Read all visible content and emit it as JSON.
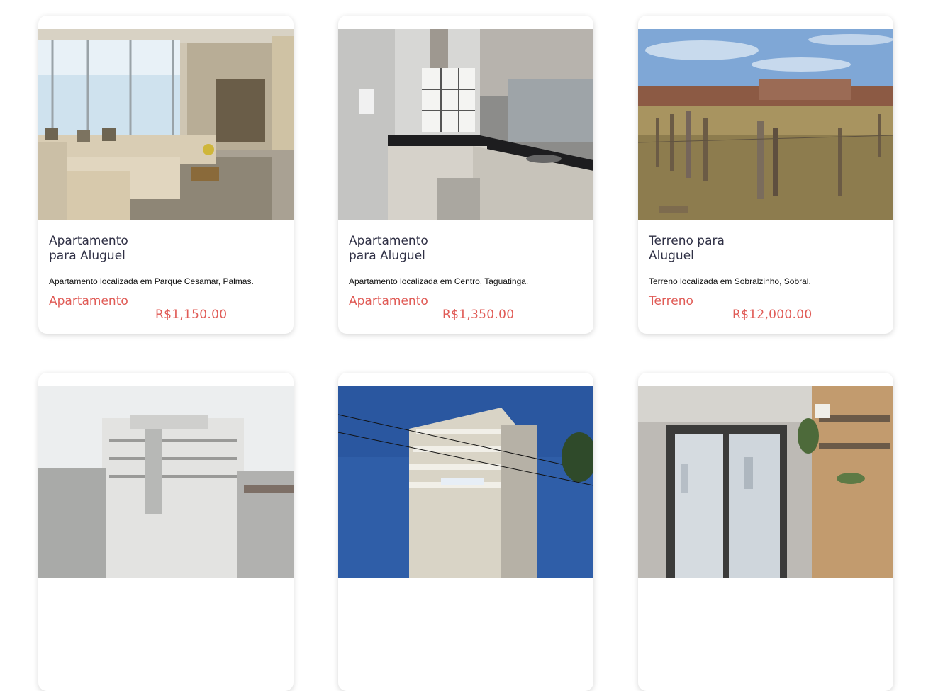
{
  "listings": [
    {
      "title_line1": "Apartamento",
      "title_line2": "para Aluguel",
      "description": "Apartamento localizada em Parque Cesamar, Palmas.",
      "type": "Apartamento",
      "price": "R$1,150.00",
      "image": "living-room-photo"
    },
    {
      "title_line1": "Apartamento",
      "title_line2": "para Aluguel",
      "description": "Apartamento localizada em Centro, Taguatinga.",
      "type": "Apartamento",
      "price": "R$1,350.00",
      "image": "kitchen-photo"
    },
    {
      "title_line1": "Terreno para",
      "title_line2": "Aluguel",
      "description": "Terreno localizada em Sobralzinho, Sobral.",
      "type": "Terreno",
      "price": "R$12,000.00",
      "image": "vacant-lot-photo"
    },
    {
      "image": "white-building-photo"
    },
    {
      "image": "prisma-building-photo"
    },
    {
      "image": "apartment-interior-photo"
    }
  ],
  "colors": {
    "accent": "#e05b56",
    "title": "#2f3045"
  }
}
